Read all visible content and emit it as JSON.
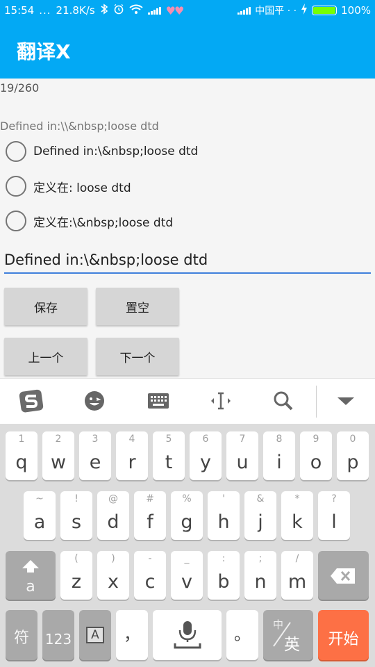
{
  "status_bar": {
    "time": "15:54",
    "dots": "...",
    "speed": "21.8K/s",
    "carrier": "中国平 · ·",
    "battery": "100%",
    "hearts": "♥♥",
    "battery_level_percent": 100
  },
  "app": {
    "title": "翻译X"
  },
  "content": {
    "counter": "19/260",
    "source_text": "Defined in:\\\\&nbsp;loose dtd",
    "options": [
      "Defined in:\\&nbsp;loose dtd",
      "定义在: loose dtd",
      "定义在:\\&nbsp;loose dtd"
    ],
    "edit_value": "Defined in:\\&nbsp;loose dtd",
    "buttons": {
      "save": "保存",
      "clear": "置空",
      "prev": "上一个",
      "next": "下一个"
    }
  },
  "ime_toolbar": {
    "icons": [
      "sogou-logo-icon",
      "emoji-icon",
      "keyboard-icon",
      "cursor-move-icon",
      "search-icon",
      "collapse-keyboard-icon"
    ]
  },
  "keyboard": {
    "row1": [
      {
        "main": "q",
        "sub": "1"
      },
      {
        "main": "w",
        "sub": "2"
      },
      {
        "main": "e",
        "sub": "3"
      },
      {
        "main": "r",
        "sub": "4"
      },
      {
        "main": "t",
        "sub": "5"
      },
      {
        "main": "y",
        "sub": "6"
      },
      {
        "main": "u",
        "sub": "7"
      },
      {
        "main": "i",
        "sub": "8"
      },
      {
        "main": "o",
        "sub": "9"
      },
      {
        "main": "p",
        "sub": "0"
      }
    ],
    "row2": [
      {
        "main": "a",
        "sub": "~"
      },
      {
        "main": "s",
        "sub": "!"
      },
      {
        "main": "d",
        "sub": "@"
      },
      {
        "main": "f",
        "sub": "#"
      },
      {
        "main": "g",
        "sub": "%"
      },
      {
        "main": "h",
        "sub": "'"
      },
      {
        "main": "j",
        "sub": "&"
      },
      {
        "main": "k",
        "sub": "*"
      },
      {
        "main": "l",
        "sub": "?"
      }
    ],
    "row3": [
      {
        "main": "z",
        "sub": "("
      },
      {
        "main": "x",
        "sub": ")"
      },
      {
        "main": "c",
        "sub": "-"
      },
      {
        "main": "v",
        "sub": "_"
      },
      {
        "main": "b",
        "sub": ":"
      },
      {
        "main": "n",
        "sub": ";"
      },
      {
        "main": "m",
        "sub": "/"
      }
    ],
    "shift_label": "a",
    "symbol_key": "符",
    "num_key": "123",
    "a_key": "A",
    "comma_key": "，",
    "period_key": "。",
    "lang_key_top": "中",
    "lang_key_bottom": "英",
    "start_key": "开始"
  }
}
